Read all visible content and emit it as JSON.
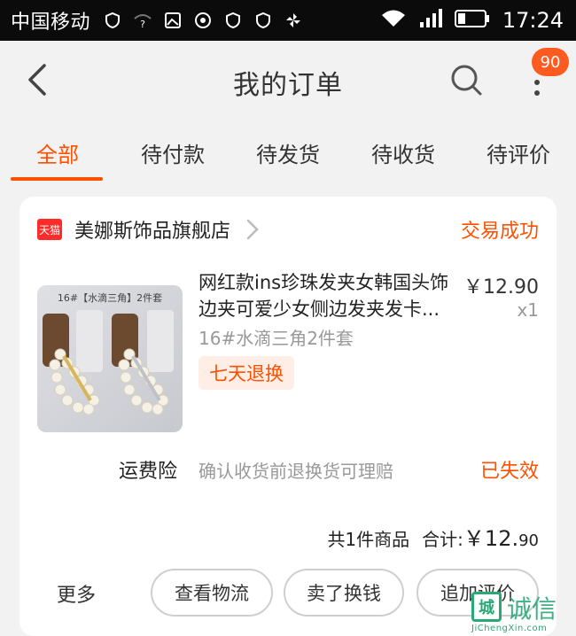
{
  "status_bar": {
    "carrier": "中国移动",
    "time": "17:24"
  },
  "header": {
    "title": "我的订单",
    "badge_count": "90"
  },
  "tabs": [
    {
      "label": "全部",
      "active": true
    },
    {
      "label": "待付款",
      "active": false
    },
    {
      "label": "待发货",
      "active": false
    },
    {
      "label": "待收货",
      "active": false
    },
    {
      "label": "待评价",
      "active": false
    }
  ],
  "order": {
    "shop_badge": "天猫",
    "shop_name": "美娜斯饰品旗舰店",
    "status": "交易成功",
    "thumb_caption": "16#【水滴三角】2件套",
    "product_title_line1": "网红款ins珍珠发夹女韩国头饰",
    "product_title_line2": "边夹可爱少女侧边发夹发卡...",
    "price": "￥12.90",
    "quantity": "x1",
    "spec": "16#水滴三角2件套",
    "service_tag": "七天退换",
    "insurance_label": "运费险",
    "insurance_desc": "确认收货前退换货可理赔",
    "insurance_status": "已失效",
    "item_count": "共1件商品",
    "total_label": "合计:",
    "total_int": "￥12.",
    "total_dec": "90",
    "more_label": "更多",
    "buttons": [
      "查看物流",
      "卖了换钱",
      "追加评价"
    ]
  },
  "watermark": {
    "logo_char": "城",
    "text": "诚信",
    "url": "JiChengXin.com"
  },
  "colors": {
    "accent": "#ff5000",
    "badge": "#ff5a1f",
    "tmall": "#ff2a2a",
    "watermark": "#2aa876"
  },
  "icons": [
    "wifi-icon",
    "signal-icon",
    "battery-icon",
    "back-arrow-icon",
    "search-icon",
    "more-vertical-icon",
    "chevron-right-icon"
  ]
}
